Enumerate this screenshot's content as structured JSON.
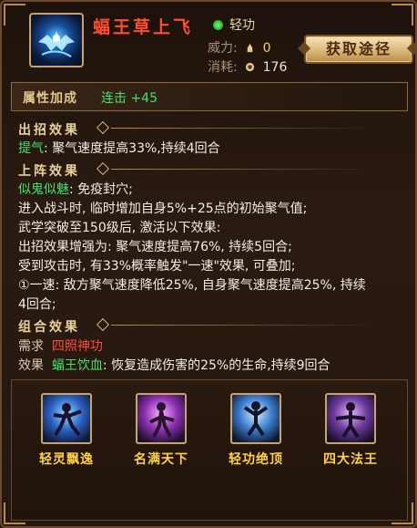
{
  "skill": {
    "name": "蝠王草上飞",
    "type_label": "轻功",
    "power_label": "威力:",
    "power_value": "0",
    "cost_label": "消耗:",
    "cost_value": "176",
    "obtain_button": "获取途径"
  },
  "attributes": {
    "label": "属性加成",
    "value": "连击 +45"
  },
  "on_cast": {
    "title": "出招效果",
    "effect_name": "提气",
    "effect_text": ": 聚气速度提高33%,持续4回合"
  },
  "on_equip": {
    "title": "上阵效果",
    "lines": [
      {
        "green": "似鬼似魅",
        "rest": ": 免疫封穴;"
      },
      {
        "green": "",
        "rest": "进入战斗时, 临时增加自身5%+25点的初始聚气值;"
      },
      {
        "green": "",
        "rest": "武学突破至150级后, 激活以下效果:"
      },
      {
        "green": "",
        "rest": "出招效果增强为: 聚气速度提高76%, 持续5回合;"
      },
      {
        "green": "",
        "rest": "受到攻击时, 有33%概率触发\"一速\"效果, 可叠加;"
      },
      {
        "green": "",
        "rest": "①一速: 敌方聚气速度降低25%, 自身聚气速度提高25%, 持续"
      },
      {
        "green": "",
        "rest": "4回合;"
      }
    ]
  },
  "combo": {
    "title": "组合效果",
    "require_label": "需求",
    "require_value": "四照神功",
    "effect_label": "效果",
    "effect_name": "蝠王饮血",
    "effect_text": ": 恢复造成伤害的25%的生命,持续9回合"
  },
  "moves": [
    {
      "name": "轻灵飘逸",
      "icon": "figure-blue-icon"
    },
    {
      "name": "名满天下",
      "icon": "figure-purple-icon"
    },
    {
      "name": "轻功绝顶",
      "icon": "figure-jump-icon"
    },
    {
      "name": "四大法王",
      "icon": "figure-violet-icon"
    }
  ]
}
